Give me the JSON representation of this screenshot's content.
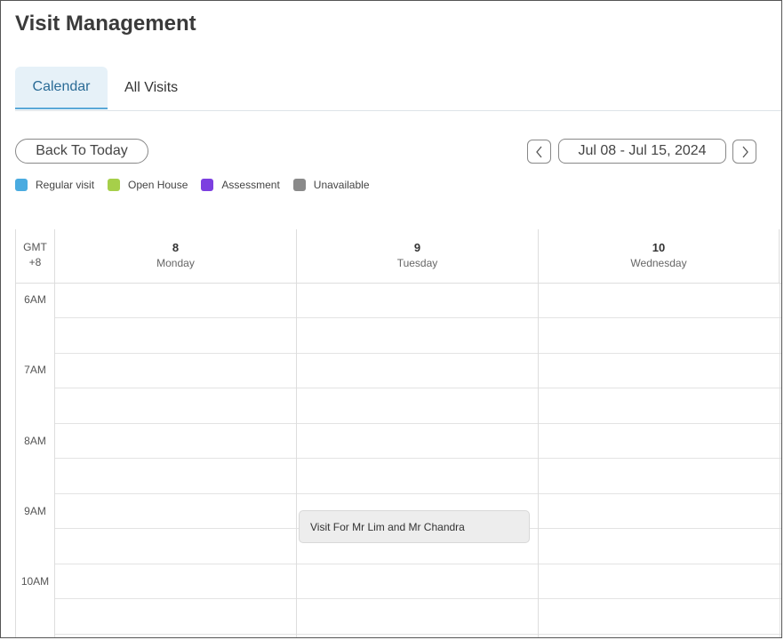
{
  "header": {
    "title": "Visit Management"
  },
  "tabs": [
    {
      "label": "Calendar",
      "active": true
    },
    {
      "label": "All Visits",
      "active": false
    }
  ],
  "toolbar": {
    "back_to_today": "Back To Today",
    "date_range": "Jul 08 - Jul 15, 2024",
    "prev_icon": "chevron-left-icon",
    "next_icon": "chevron-right-icon"
  },
  "legend": [
    {
      "label": "Regular visit",
      "color": "#4aabe0"
    },
    {
      "label": "Open House",
      "color": "#a6cf4a"
    },
    {
      "label": "Assessment",
      "color": "#7c3fe0"
    },
    {
      "label": "Unavailable",
      "color": "#8a8a8a"
    }
  ],
  "calendar": {
    "timezone_line1": "GMT",
    "timezone_line2": "+8",
    "days": [
      {
        "num": "8",
        "name": "Monday"
      },
      {
        "num": "9",
        "name": "Tuesday"
      },
      {
        "num": "10",
        "name": "Wednesday"
      }
    ],
    "hours": [
      "6AM",
      "7AM",
      "8AM",
      "9AM",
      "10AM"
    ],
    "events": [
      {
        "title": "Visit For Mr Lim and Mr Chandra",
        "day": "9",
        "start": "9AM"
      }
    ]
  }
}
